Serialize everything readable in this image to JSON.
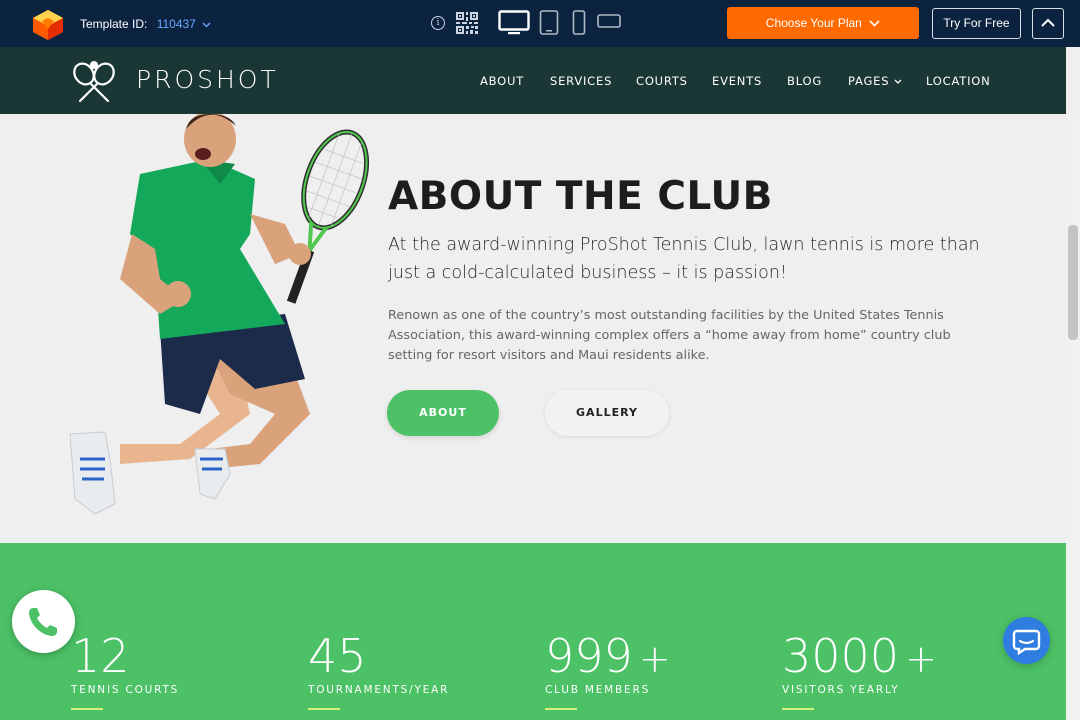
{
  "preview_bar": {
    "template_label": "Template ID:",
    "template_id": "110437",
    "plan_button": "Choose Your Plan",
    "try_button": "Try For Free",
    "icons": [
      "logo-icon",
      "info-icon",
      "qr-code-icon",
      "desktop-icon",
      "tablet-icon",
      "mobile-icon",
      "mobile-landscape-icon",
      "chevron-down-icon",
      "chevron-up-icon"
    ],
    "plan_color": "#ff6a00",
    "bar_color": "#0c2340"
  },
  "header": {
    "brand": "PROSHOT",
    "nav": [
      "ABOUT",
      "SERVICES",
      "COURTS",
      "EVENTS",
      "BLOG",
      "PAGES",
      "LOCATION"
    ],
    "bg_color": "#1a3635"
  },
  "about": {
    "title": "ABOUT THE CLUB",
    "lead": "At the award-winning ProShot Tennis Club, lawn tennis is more than just a cold-calculated business – it is  passion!",
    "body": "Renown as one of the country’s most outstanding facilities by the United States Tennis Association, this award-winning complex offers a “home away from home” country club setting for resort visitors and Maui residents alike.",
    "primary_button": "ABOUT",
    "secondary_button": "GALLERY",
    "accent": "#4cc166"
  },
  "stats": [
    {
      "number": "12",
      "plus": "",
      "label": "TENNIS COURTS"
    },
    {
      "number": "45",
      "plus": "",
      "label": "TOURNAMENTS/YEAR"
    },
    {
      "number": "999",
      "plus": "+",
      "label": "CLUB MEMBERS"
    },
    {
      "number": "3000",
      "plus": "+",
      "label": "VISITORS YEARLY"
    }
  ]
}
